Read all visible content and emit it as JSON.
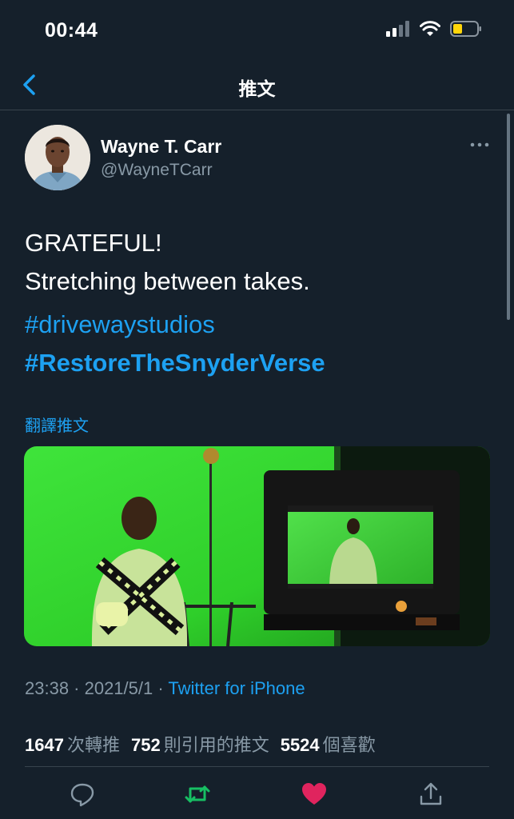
{
  "status_bar": {
    "time": "00:44",
    "icons": [
      "cellular-signal-icon",
      "wifi-icon",
      "battery-icon"
    ]
  },
  "nav": {
    "title": "推文",
    "back_icon": "chevron-left-icon"
  },
  "tweet": {
    "author": {
      "name": "Wayne T. Carr",
      "handle": "@WayneTCarr"
    },
    "text_lines": [
      "GRATEFUL!",
      "Stretching between takes."
    ],
    "hashtags": [
      "#drivewaystudios",
      "#RestoreTheSnyderVerse"
    ],
    "translate_label": "翻譯推文",
    "timestamp": "23:38 · 2021/5/1 · ",
    "source": "Twitter for iPhone",
    "stats": {
      "retweets_count": "1647",
      "retweets_label": "次轉推",
      "quotes_count": "752",
      "quotes_label": "則引用的推文",
      "likes_count": "5524",
      "likes_label": "個喜歡"
    },
    "actions": [
      "reply-icon",
      "retweet-icon",
      "like-icon",
      "share-icon"
    ]
  },
  "colors": {
    "background": "#15202b",
    "accent": "#1da1f2",
    "secondary_text": "#8899a6",
    "retweet_active": "#17bf63",
    "like_active": "#e0245e",
    "divider": "#38444d"
  }
}
